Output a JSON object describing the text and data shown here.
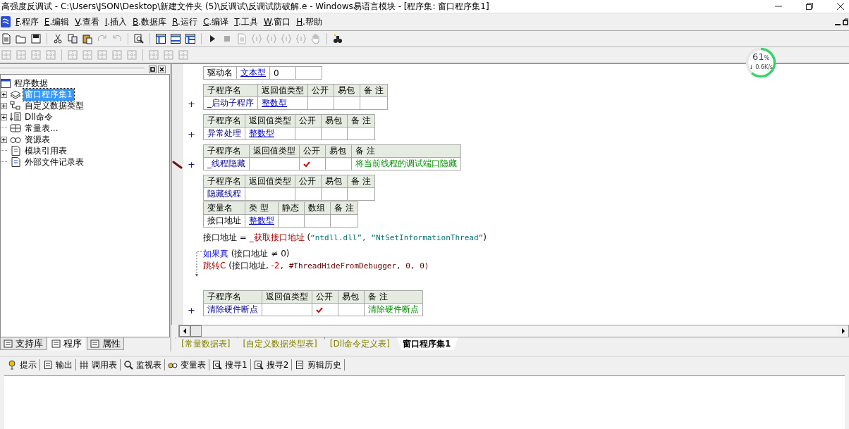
{
  "window": {
    "title": "高强度反调试 - C:\\Users\\JSON\\Desktop\\新建文件夹 (5)\\反调试\\反调试防破解.e - Windows易语言模块 - [程序集: 窗口程序集1]"
  },
  "menu": [
    {
      "key": "F",
      "label": ".程序"
    },
    {
      "key": "E",
      "label": ".编辑"
    },
    {
      "key": "V",
      "label": ".查看"
    },
    {
      "key": "I",
      "label": ".插入"
    },
    {
      "key": "B",
      "label": ".数据库"
    },
    {
      "key": "R",
      "label": ".运行"
    },
    {
      "key": "C",
      "label": ".编译"
    },
    {
      "key": "T",
      "label": ".工具"
    },
    {
      "key": "W",
      "label": ".窗口"
    },
    {
      "key": "H",
      "label": ".帮助"
    }
  ],
  "meter": {
    "value": "61",
    "unit": "%",
    "speed": "↓ 0.6K/s",
    "level": 0.61
  },
  "tree": {
    "label": "程序数据",
    "children": [
      {
        "label": "窗口程序集1",
        "selected": true,
        "collapsed": true
      },
      {
        "label": "自定义数据类型",
        "selected": false,
        "collapsed": true
      },
      {
        "label": "Dll命令",
        "selected": false,
        "collapsed": true
      },
      {
        "label": "常量表...",
        "selected": false,
        "collapsed": false
      },
      {
        "label": "资源表",
        "selected": false,
        "collapsed": true
      },
      {
        "label": "模块引用表",
        "selected": false,
        "collapsed": false
      },
      {
        "label": "外部文件记录表",
        "selected": false,
        "collapsed": false
      }
    ]
  },
  "side_tabs": [
    {
      "label": "支持库",
      "selected": false
    },
    {
      "label": "程序",
      "selected": true
    },
    {
      "label": "属性",
      "selected": false
    }
  ],
  "editor": {
    "blocks": [
      {
        "kind": "table",
        "modified": false,
        "rows": [
          [
            {
              "text": "驱动名"
            },
            {
              "text": "文本型",
              "kind": "type"
            },
            {
              "text": "0"
            },
            {}
          ]
        ]
      },
      {
        "kind": "table",
        "expand": "+",
        "modified": false,
        "headers": [
          "子程序名",
          "返回值类型",
          "公开",
          "易包",
          "备 注"
        ],
        "rows": [
          [
            {
              "text": "_启动子程序",
              "kind": "name"
            },
            {
              "text": "整数型",
              "kind": "type"
            },
            {
              "checked": false
            },
            {},
            {}
          ]
        ]
      },
      {
        "kind": "table",
        "expand": "+",
        "modified": false,
        "headers": [
          "子程序名",
          "返回值类型",
          "公开",
          "易包",
          "备 注"
        ],
        "rows": [
          [
            {
              "text": "异常处理",
              "kind": "name"
            },
            {
              "text": "整数型",
              "kind": "type"
            },
            {
              "checked": false
            },
            {},
            {}
          ]
        ]
      },
      {
        "kind": "table",
        "expand": "+",
        "modified": true,
        "headers": [
          "子程序名",
          "返回值类型",
          "公开",
          "易包",
          "备 注"
        ],
        "rows": [
          [
            {
              "text": "_线程隐藏",
              "kind": "name"
            },
            {},
            {
              "checked": true
            },
            {},
            {
              "text": "将当前线程的调试端口隐藏",
              "kind": "comment"
            }
          ]
        ]
      },
      {
        "kind": "table",
        "modified": false,
        "headers": [
          "子程序名",
          "返回值类型",
          "公开",
          "易包",
          "备 注"
        ],
        "rows": [
          [
            {
              "text": "隐藏线程",
              "kind": "name"
            },
            {},
            {
              "checked": false
            },
            {},
            {}
          ]
        ]
      },
      {
        "kind": "table",
        "modified": false,
        "headers": [
          "变量名",
          "类 型",
          "静态",
          "数组",
          "备 注"
        ],
        "rows": [
          [
            {
              "text": "接口地址"
            },
            {
              "text": "整数型",
              "kind": "type"
            },
            {
              "checked": false
            },
            {},
            {}
          ]
        ]
      },
      {
        "kind": "code",
        "tokens": [
          {
            "text": "接口地址 = ",
            "kind": "var"
          },
          {
            "text": "_获取接口地址",
            "kind": "func"
          },
          {
            "text": " (",
            "kind": "var"
          },
          {
            "text": "“ntdll.dll”, “NtSetInformationThread”",
            "kind": "str"
          },
          {
            "text": ")",
            "kind": "var"
          }
        ]
      },
      {
        "kind": "flow",
        "tokens": [
          {
            "text": "如果真",
            "kind": "keyword"
          },
          {
            "text": " (接口地址 ≠ 0)",
            "kind": "var"
          }
        ],
        "children": [
          {
            "tokens": [
              {
                "text": "跳转C",
                "kind": "func"
              },
              {
                "text": " (接口地址, ",
                "kind": "var"
              },
              {
                "text": "-2",
                "kind": "num"
              },
              {
                "text": ", #ThreadHideFromDebugger, 0, 0)",
                "kind": "const"
              }
            ]
          }
        ]
      },
      {
        "kind": "table",
        "expand": "+",
        "modified": false,
        "headers": [
          "子程序名",
          "返回值类型",
          "公开",
          "易包",
          "备 注"
        ],
        "rows": [
          [
            {
              "text": "清除硬件断点",
              "kind": "name"
            },
            {},
            {
              "checked": true
            },
            {},
            {
              "text": "清除硬件断点",
              "kind": "comment"
            }
          ]
        ]
      }
    ]
  },
  "editor_tabs": [
    {
      "label": "[常量数据表]",
      "selected": false
    },
    {
      "label": "[自定义数据类型表]",
      "selected": false
    },
    {
      "label": "[Dll命令定义表]",
      "selected": false
    },
    {
      "label": "窗口程序集1",
      "selected": true
    }
  ],
  "output_tabs": [
    {
      "label": "提示"
    },
    {
      "label": "输出"
    },
    {
      "label": "调用表"
    },
    {
      "label": "监视表"
    },
    {
      "label": "变量表"
    },
    {
      "label": "搜寻1"
    },
    {
      "label": "搜寻2"
    },
    {
      "label": "剪辑历史"
    }
  ]
}
